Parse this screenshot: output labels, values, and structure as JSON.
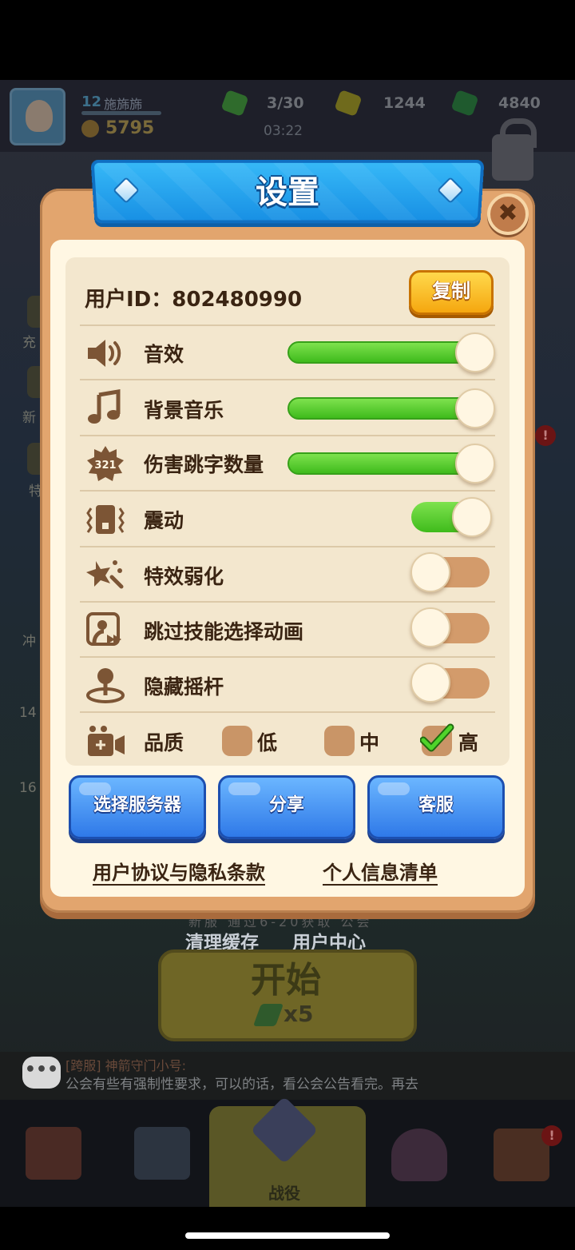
{
  "background": {
    "player": {
      "level": "12",
      "name": "施旆旆",
      "power": "5795"
    },
    "resources": [
      {
        "icon": "energy-icon",
        "value": "3/30",
        "color": "#2f6b2c"
      },
      {
        "icon": "gold-icon",
        "value": "1244",
        "color": "#6f6a1c"
      },
      {
        "icon": "gem-green-icon",
        "value": "4840",
        "color": "#1f5a2e"
      }
    ],
    "timer": "03:22",
    "side_labels": [
      "充",
      "新",
      "特",
      "冲",
      "14",
      "16"
    ],
    "breadcrumb": "新服   通过6-20获取   公会",
    "links": {
      "clear_cache": "清理缓存",
      "user_center": "用户中心"
    },
    "start": {
      "label": "开始",
      "cost": "x5"
    },
    "chat": {
      "icon": "•••",
      "sender": "[跨服] 神箭守门小号:",
      "message": "公会有些有强制性要求，可以的话，看公会公告看完。再去"
    },
    "nav": {
      "center_label": "战役",
      "badge": "!"
    }
  },
  "dialog": {
    "title": "设置",
    "close": "✖",
    "user_id_label": "用户ID：802480990",
    "copy_label": "复制",
    "sliders": [
      {
        "label": "音效",
        "icon": "speaker-icon",
        "value": 1.0
      },
      {
        "label": "背景音乐",
        "icon": "music-note-icon",
        "value": 1.0
      },
      {
        "label": "伤害跳字数量",
        "icon": "damage-number-icon",
        "icon_text": "321",
        "value": 1.0
      }
    ],
    "toggles": [
      {
        "label": "震动",
        "icon": "vibration-icon",
        "on": true
      },
      {
        "label": "特效弱化",
        "icon": "effects-icon",
        "on": false
      },
      {
        "label": "跳过技能选择动画",
        "icon": "skip-animation-icon",
        "on": false
      },
      {
        "label": "隐藏摇杆",
        "icon": "joystick-icon",
        "on": false
      }
    ],
    "quality": {
      "label": "品质",
      "icon": "camera-icon",
      "options": [
        {
          "label": "低",
          "checked": false
        },
        {
          "label": "中",
          "checked": false
        },
        {
          "label": "高",
          "checked": true
        }
      ]
    },
    "buttons": {
      "server": "选择服务器",
      "share": "分享",
      "support": "客服"
    },
    "links": {
      "agreement": "用户协议与隐私条款",
      "personal_info": "个人信息清单"
    },
    "colors": {
      "accent_green": "#4fc629",
      "banner_blue": "#1f95e8",
      "frame": "#e2a56e",
      "copy_yellow": "#f8bf24"
    }
  }
}
